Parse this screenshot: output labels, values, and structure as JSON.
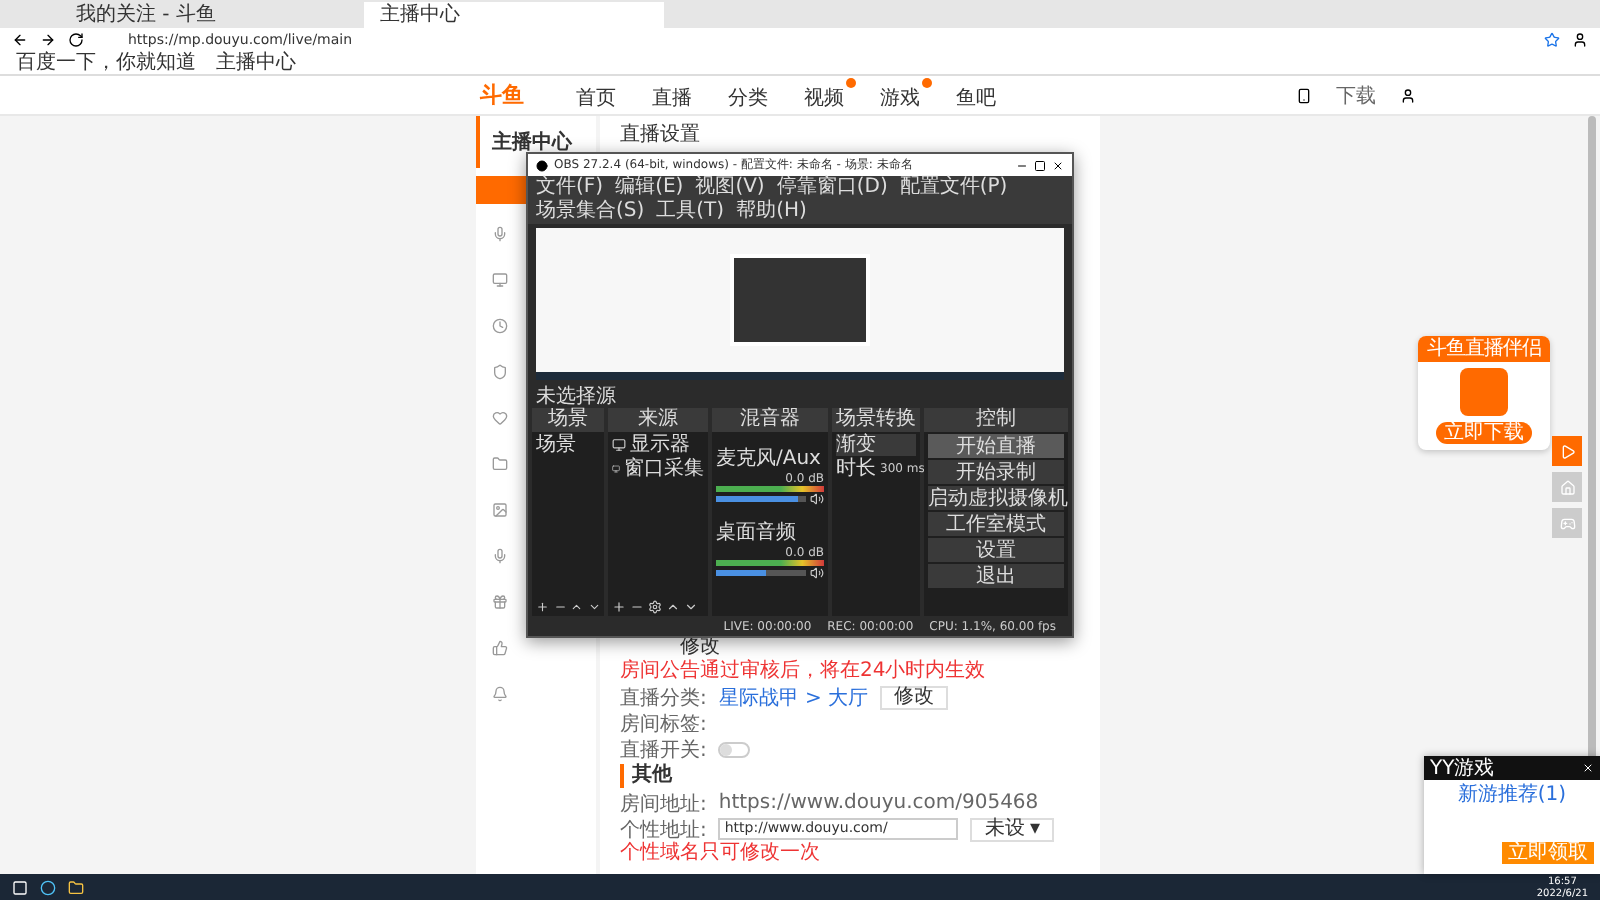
{
  "browser": {
    "tabs": [
      {
        "title": "我的关注 - 斗鱼",
        "selected": false
      },
      {
        "title": "主播中心",
        "selected": true
      }
    ],
    "url": "https://mp.douyu.com/live/main",
    "bookmarks": [
      "百度一下，你就知道",
      "主播中心"
    ]
  },
  "site": {
    "logo": "斗鱼",
    "nav": [
      {
        "label": "首页",
        "badge": false
      },
      {
        "label": "直播",
        "badge": false
      },
      {
        "label": "分类",
        "badge": false
      },
      {
        "label": "视频",
        "badge": true
      },
      {
        "label": "游戏",
        "badge": true
      },
      {
        "label": "鱼吧",
        "badge": false
      }
    ],
    "download": "下载"
  },
  "sidebar": {
    "title": "主播中心"
  },
  "main": {
    "title": "直播设置",
    "edit": "修改",
    "warning": "房间公告通过审核后，将在24小时内生效",
    "rows": [
      {
        "kind": "link",
        "label": "直播分类:",
        "value": "星际战甲 > 大厅",
        "button": "修改"
      },
      {
        "kind": "text",
        "label": "房间标签:"
      },
      {
        "kind": "toggle",
        "label": "直播开关:",
        "on": false
      }
    ],
    "section": "其他",
    "address_label": "房间地址:",
    "address": "https://www.douyu.com/905468",
    "custom_label": "个性地址:",
    "custom_value": "http://www.douyu.com/",
    "custom_button": "未设 ▾",
    "custom_hint": "个性域名只可修改一次"
  },
  "obs": {
    "title": "OBS 27.2.4 (64-bit, windows) - 配置文件: 未命名 - 场景: 未命名",
    "menu": [
      "文件(F)",
      "编辑(E)",
      "视图(V)",
      "停靠窗口(D)",
      "配置文件(P)",
      "场景集合(S)",
      "工具(T)",
      "帮助(H)"
    ],
    "scene_bar": "未选择源",
    "docks": [
      "场景",
      "来源",
      "混音器",
      "场景转换",
      "控制"
    ],
    "scenes": [
      {
        "name": "场景",
        "selected": false
      }
    ],
    "sources": [
      "显示器",
      "窗口采集"
    ],
    "mixer": [
      {
        "name": "麦克风/Aux",
        "reading": "0.0 dB",
        "level": 0.9
      },
      {
        "name": "桌面音频",
        "reading": "0.0 dB",
        "level": 0.55
      }
    ],
    "transition": "渐变",
    "duration_label": "时长",
    "duration": "300 ms",
    "controls": [
      {
        "label": "开始直播",
        "selected": true
      },
      {
        "label": "开始录制",
        "selected": false
      },
      {
        "label": "启动虚拟摄像机",
        "selected": false
      },
      {
        "label": "工作室模式",
        "selected": false
      },
      {
        "label": "设置",
        "selected": false
      },
      {
        "label": "退出",
        "selected": false
      }
    ],
    "status": [
      "LIVE: 00:00:00",
      "REC: 00:00:00",
      "CPU: 1.1%, 60.00 fps"
    ]
  },
  "promo": {
    "title": "斗鱼直播伴侣",
    "button": "立即下载"
  },
  "notification": {
    "app": "YY游戏",
    "title": "新游推荐(1)",
    "button": "立即领取"
  },
  "taskbar": {
    "time": "16:57",
    "date": "2022/6/21"
  }
}
